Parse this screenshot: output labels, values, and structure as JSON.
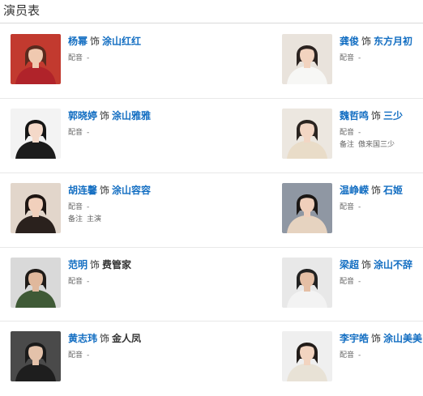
{
  "section_title": "演员表",
  "role_connector": "饰",
  "labels": {
    "dub": "配音",
    "note": "备注"
  },
  "cast": [
    {
      "actor": "杨幂",
      "role": "涂山红红",
      "role_link": true,
      "dub": "-",
      "note": null,
      "photo": {
        "bg": "#c23a2f",
        "skin": "#f0c9b0",
        "hair": "#5a2a1e",
        "cloth": "#b0232a"
      }
    },
    {
      "actor": "龚俊",
      "role": "东方月初",
      "role_link": true,
      "dub": "-",
      "note": null,
      "photo": {
        "bg": "#e9e3dc",
        "skin": "#f2d3bf",
        "hair": "#2b2320",
        "cloth": "#f7f7f5"
      }
    },
    {
      "actor": "郭晓婷",
      "role": "涂山雅雅",
      "role_link": true,
      "dub": "-",
      "note": null,
      "photo": {
        "bg": "#f3f3f3",
        "skin": "#f4d9c9",
        "hair": "#151515",
        "cloth": "#1b1b1b"
      }
    },
    {
      "actor": "魏哲鸣",
      "role": "三少",
      "role_link": true,
      "dub": "-",
      "note": "傲来国三少",
      "photo": {
        "bg": "#ece7e0",
        "skin": "#f2d6c4",
        "hair": "#2a2420",
        "cloth": "#e9dcc8"
      }
    },
    {
      "actor": "胡连馨",
      "role": "涂山容容",
      "role_link": true,
      "dub": "-",
      "note": "主演",
      "photo": {
        "bg": "#e2d6cb",
        "skin": "#f1d0bc",
        "hair": "#1d1512",
        "cloth": "#2a211d"
      }
    },
    {
      "actor": "温峥嵘",
      "role": "石姬",
      "role_link": true,
      "dub": "-",
      "note": null,
      "photo": {
        "bg": "#8f97a3",
        "skin": "#f0cfbb",
        "hair": "#1b1715",
        "cloth": "#e6d3c0"
      }
    },
    {
      "actor": "范明",
      "role": "费管家",
      "role_link": false,
      "dub": "-",
      "note": null,
      "photo": {
        "bg": "#d9d9d9",
        "skin": "#e0b89c",
        "hair": "#1f1b18",
        "cloth": "#3f5a36"
      }
    },
    {
      "actor": "梁超",
      "role": "涂山不辞",
      "role_link": true,
      "dub": "-",
      "note": null,
      "photo": {
        "bg": "#e8e8e8",
        "skin": "#e5bfa5",
        "hair": "#222",
        "cloth": "#f3f3f3"
      }
    },
    {
      "actor": "黄志玮",
      "role": "金人凤",
      "role_link": false,
      "dub": "-",
      "note": null,
      "photo": {
        "bg": "#4a4a4a",
        "skin": "#e4c2aa",
        "hair": "#1a1a1a",
        "cloth": "#1e1e1e"
      }
    },
    {
      "actor": "李宇皓",
      "role": "涂山美美",
      "role_link": true,
      "dub": "-",
      "note": null,
      "photo": {
        "bg": "#efefef",
        "skin": "#f2d4c0",
        "hair": "#221c19",
        "cloth": "#e8e2d6"
      }
    }
  ]
}
